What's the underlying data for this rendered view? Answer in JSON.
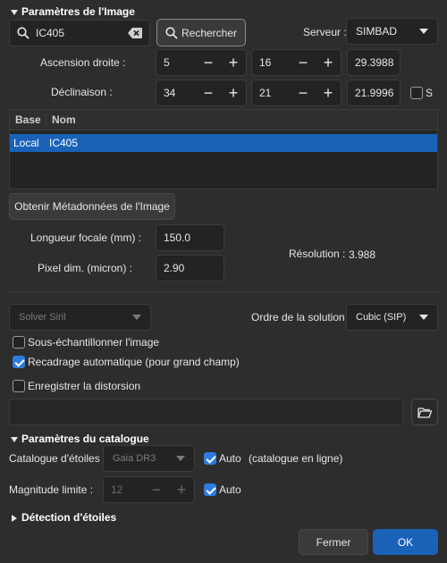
{
  "image_params": {
    "title": "Paramètres de l'Image",
    "search_value": "IC405",
    "search_button": "Rechercher",
    "server_label": "Serveur :",
    "server_value": "SIMBAD",
    "ra_label": "Ascension droite :",
    "ra_h": "5",
    "ra_m": "16",
    "ra_s": "29.3988",
    "dec_label": "Déclinaison :",
    "dec_d": "34",
    "dec_m": "21",
    "dec_s": "21.9996",
    "south_label": "S",
    "table": {
      "columns": [
        "Base",
        "Nom"
      ],
      "rows": [
        {
          "base": "Local",
          "name": "IC405"
        }
      ]
    },
    "metadata_button": "Obtenir Métadonnées de l'Image",
    "focal_label": "Longueur focale (mm) :",
    "focal_value": "150.0",
    "pixel_label": "Pixel dim. (micron) :",
    "pixel_value": "2.90",
    "resolution_label": "Résolution :",
    "resolution_value": "3.988"
  },
  "solver": {
    "solver_value": "Solver Siril",
    "order_label": "Ordre de la solution :",
    "order_value": "Cubic (SIP)",
    "downsample_label": "Sous-échantillonner l'image",
    "downsample_checked": false,
    "autocrop_label": "Recadrage automatique (pour grand champ)",
    "autocrop_checked": true,
    "distortion_label": "Enregistrer la distorsion",
    "distortion_checked": false,
    "distortion_path": ""
  },
  "catalog": {
    "title": "Paramètres du catalogue",
    "catalog_label": "Catalogue d'étoiles :",
    "catalog_value": "Gaia DR3",
    "auto_label": "Auto",
    "online_label": "(catalogue en ligne)",
    "mag_label": "Magnitude limite :",
    "mag_value": "12",
    "mag_auto_label": "Auto"
  },
  "detection": {
    "title": "Détection d'étoiles"
  },
  "footer": {
    "cancel": "Fermer",
    "ok": "OK"
  },
  "colors": {
    "accent": "#2e7be0",
    "selection": "#1a62b8",
    "background": "#2d2d2d"
  }
}
